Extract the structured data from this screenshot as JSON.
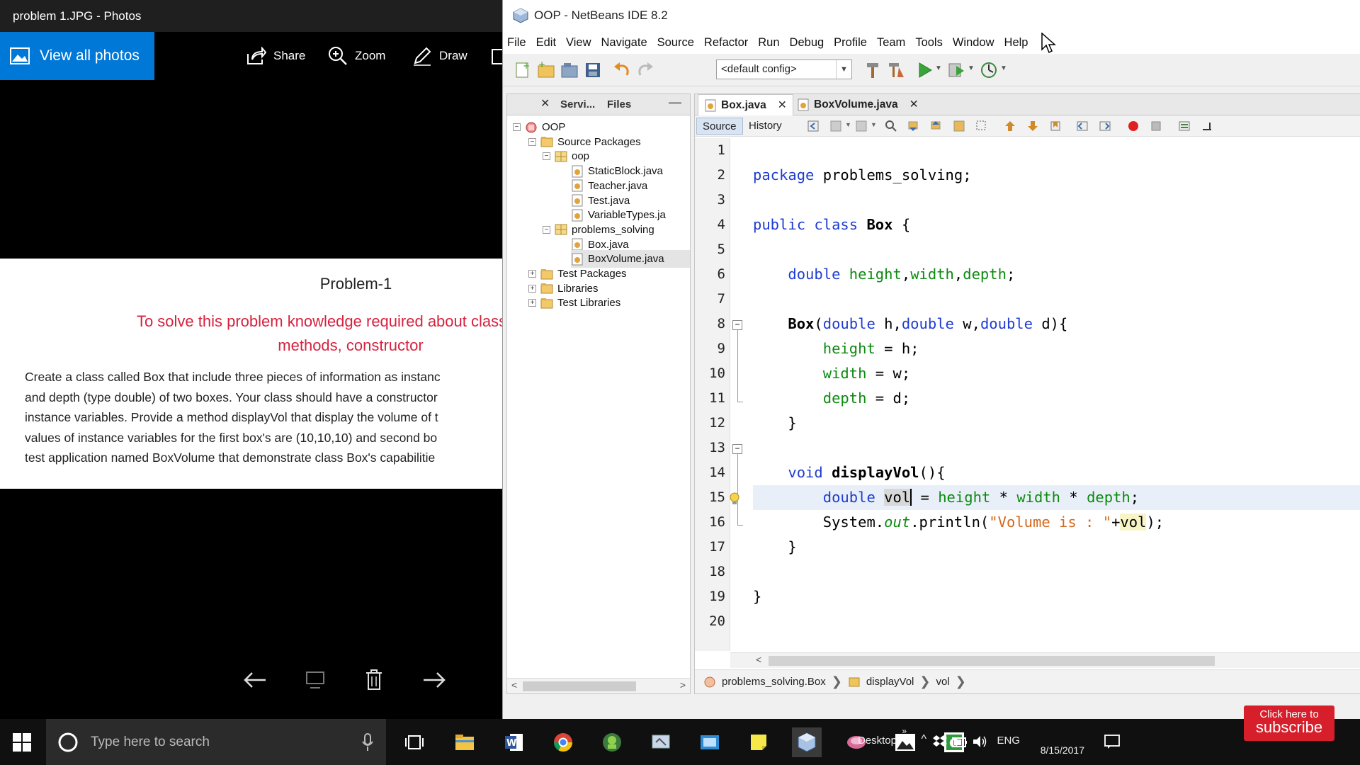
{
  "photos": {
    "window_title": "problem 1.JPG - Photos",
    "toolbar": {
      "view_all": "View all photos",
      "share": "Share",
      "zoom": "Zoom",
      "draw": "Draw"
    },
    "document": {
      "title": "Problem-1",
      "requirement_line1": "To solve this problem knowledge required about class, objects",
      "requirement_line2": "methods, constructor",
      "body_lines": [
        "Create a class called Box that include three pieces of information as instanc",
        "and depth (type double) of two boxes. Your class should have a constructor",
        "instance variables. Provide a method displayVol that display the volume of t",
        "values of instance variables for the first box's are (10,10,10) and second bo",
        "test application named BoxVolume that demonstrate class Box's capabilitie"
      ]
    },
    "icons": [
      "back-arrow-icon",
      "slideshow-icon",
      "trash-icon",
      "forward-arrow-icon"
    ]
  },
  "netbeans": {
    "window_title": "OOP - NetBeans IDE 8.2",
    "menu": [
      "File",
      "Edit",
      "View",
      "Navigate",
      "Source",
      "Refactor",
      "Run",
      "Debug",
      "Profile",
      "Team",
      "Tools",
      "Window",
      "Help"
    ],
    "config": "<default config>",
    "project_tabs": [
      "Servi...",
      "Files"
    ],
    "tree": [
      {
        "label": "OOP",
        "level": 0,
        "expander": "−",
        "icon": "project"
      },
      {
        "label": "Source Packages",
        "level": 1,
        "expander": "−",
        "icon": "folder"
      },
      {
        "label": "oop",
        "level": 2,
        "expander": "−",
        "icon": "package"
      },
      {
        "label": "StaticBlock.java",
        "level": 3,
        "expander": "",
        "icon": "java"
      },
      {
        "label": "Teacher.java",
        "level": 3,
        "expander": "",
        "icon": "java"
      },
      {
        "label": "Test.java",
        "level": 3,
        "expander": "",
        "icon": "java"
      },
      {
        "label": "VariableTypes.ja",
        "level": 3,
        "expander": "",
        "icon": "java"
      },
      {
        "label": "problems_solving",
        "level": 2,
        "expander": "−",
        "icon": "package"
      },
      {
        "label": "Box.java",
        "level": 3,
        "expander": "",
        "icon": "java"
      },
      {
        "label": "BoxVolume.java",
        "level": 3,
        "expander": "",
        "icon": "java",
        "selected": true
      },
      {
        "label": "Test Packages",
        "level": 1,
        "expander": "+",
        "icon": "folder"
      },
      {
        "label": "Libraries",
        "level": 1,
        "expander": "+",
        "icon": "folder"
      },
      {
        "label": "Test Libraries",
        "level": 1,
        "expander": "+",
        "icon": "folder"
      }
    ],
    "file_tabs": [
      "Box.java",
      "BoxVolume.java"
    ],
    "source_tabs": [
      "Source",
      "History"
    ],
    "line_numbers": [
      "1",
      "2",
      "3",
      "4",
      "5",
      "6",
      "7",
      "8",
      "9",
      "10",
      "11",
      "12",
      "13",
      "14",
      "15",
      "16",
      "17",
      "18",
      "19",
      "20"
    ],
    "code": {
      "l2": {
        "kw": "package",
        "rest": " problems_solving;"
      },
      "l4": {
        "kw1": "public",
        "kw2": "class",
        "name": "Box",
        "rest": " {"
      },
      "l6": {
        "kw": "double",
        "f1": "height",
        "f2": "width",
        "f3": "depth"
      },
      "l8": {
        "name": "Box",
        "p1kw": "double",
        "p1": " h,",
        "p2kw": "double",
        "p2": " w,",
        "p3kw": "double",
        "p3": " d){"
      },
      "l9": {
        "f": "height",
        "rest": " = h;"
      },
      "l10": {
        "f": "width",
        "rest": " = w;"
      },
      "l11": {
        "f": "depth",
        "rest": " = d;"
      },
      "l12": "}",
      "l14": {
        "kw": "void",
        "name": "displayVol",
        "rest": "(){"
      },
      "l15": {
        "kw": "double",
        "var": "vol",
        "eq": " = ",
        "f1": "height",
        "op1": " * ",
        "f2": "width",
        "op2": " * ",
        "f3": "depth",
        "end": ";"
      },
      "l16": {
        "sys": "System.",
        "out": "out",
        "println": ".println(",
        "str": "\"Volume is : \"",
        "plus": "+",
        "var": "vol",
        "end": ");"
      },
      "l17": "}",
      "l19": "}"
    },
    "breadcrumbs": [
      "problems_solving.Box",
      "displayVol",
      "vol"
    ]
  },
  "taskbar": {
    "search_placeholder": "Type here to search",
    "desktop": "Desktop",
    "lang": "ENG",
    "date": "8/15/2017"
  },
  "overlay": {
    "subscribe_l1": "Click here to",
    "subscribe_l2": "subscribe"
  }
}
